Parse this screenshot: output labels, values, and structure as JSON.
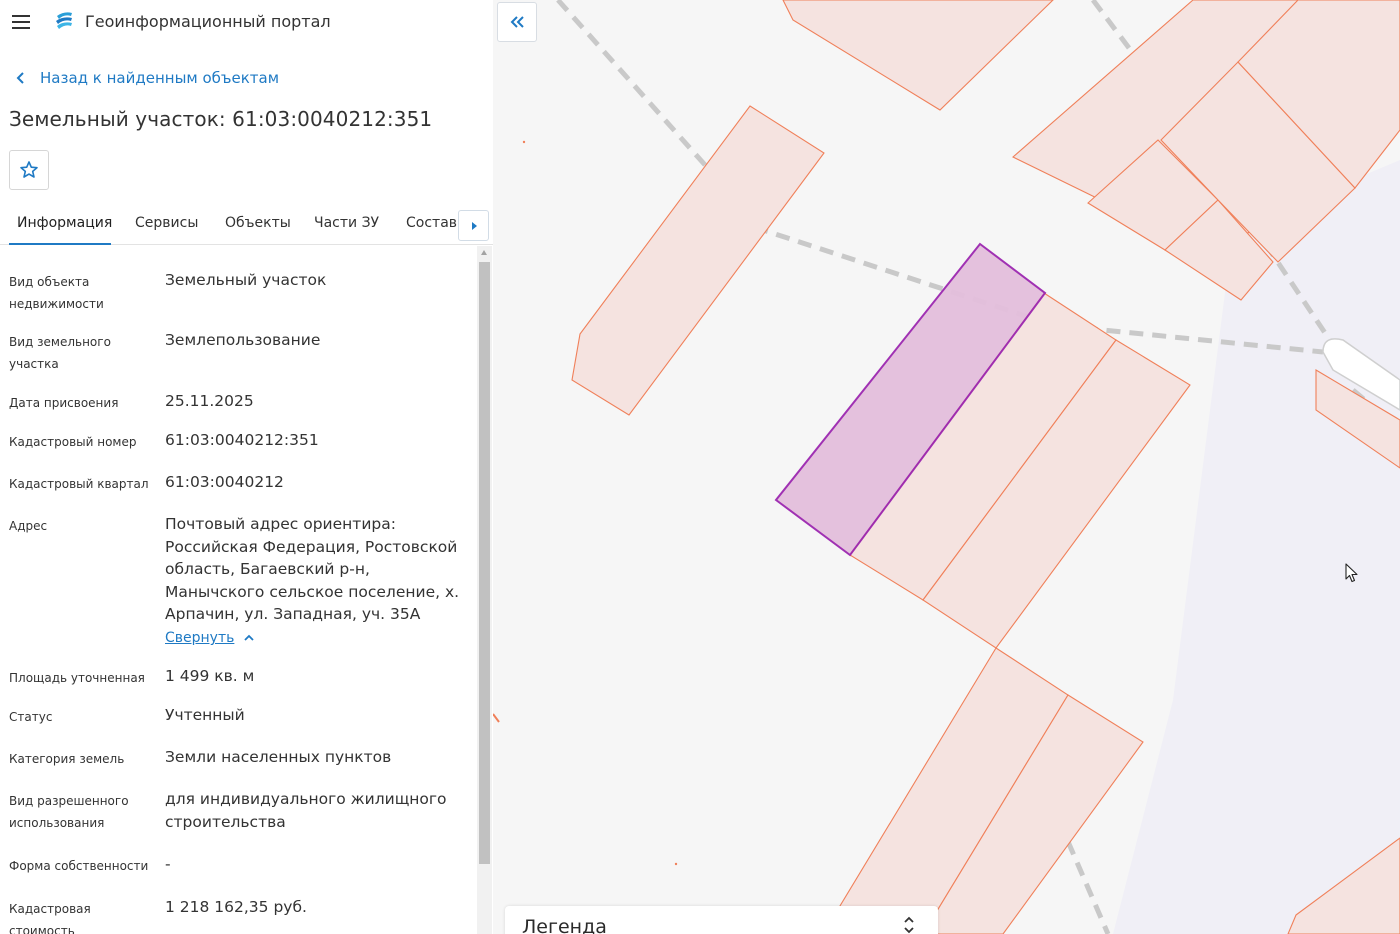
{
  "app": {
    "title": "Геоинформационный портал",
    "logo_icon": "portal-logo-icon",
    "menu_icon": "hamburger-menu-icon"
  },
  "nav": {
    "back_label": "Назад к найденным объектам"
  },
  "object": {
    "title": "Земельный участок: 61:03:0040212:351"
  },
  "tabs": [
    {
      "label": "Информация",
      "active": true
    },
    {
      "label": "Сервисы",
      "active": false
    },
    {
      "label": "Объекты",
      "active": false
    },
    {
      "label": "Части ЗУ",
      "active": false
    },
    {
      "label": "Состав",
      "active": false
    }
  ],
  "info": [
    {
      "label": "Вид объекта недвижимости",
      "value": "Земельный участок"
    },
    {
      "label": "Вид земельного участка",
      "value": "Землепользование"
    },
    {
      "label": "Дата присвоения",
      "value": "25.11.2025"
    },
    {
      "label": "Кадастровый номер",
      "value": "61:03:0040212:351"
    },
    {
      "label": "Кадастровый квартал",
      "value": "61:03:0040212"
    },
    {
      "label": "Адрес",
      "value": "Почтовый адрес ориентира: Российская Федерация, Ростовской область, Багаевский р-н, Манычского сельское поселение, х. Арпачин, ул. Западная, уч. 35А"
    },
    {
      "label": "Площадь уточненная",
      "value": "1 499 кв. м"
    },
    {
      "label": "Статус",
      "value": "Учтенный"
    },
    {
      "label": "Категория земель",
      "value": "Земли населенных пунктов"
    },
    {
      "label": "Вид разрешенного использования",
      "value": "для индивидуального жилищного строительства"
    },
    {
      "label": "Форма собственности",
      "value": "-"
    },
    {
      "label": "Кадастровая стоимость",
      "value": "1 218 162,35 руб."
    }
  ],
  "address_toggle_label": "Свернуть",
  "map": {
    "legend_label": "Легенда",
    "parcel_fill": "#f5e3e0",
    "parcel_stroke": "#f0805a",
    "selected_fill": "#e4bfdc",
    "selected_stroke": "#9c27b0"
  },
  "colors": {
    "accent": "#1f7ac4"
  }
}
